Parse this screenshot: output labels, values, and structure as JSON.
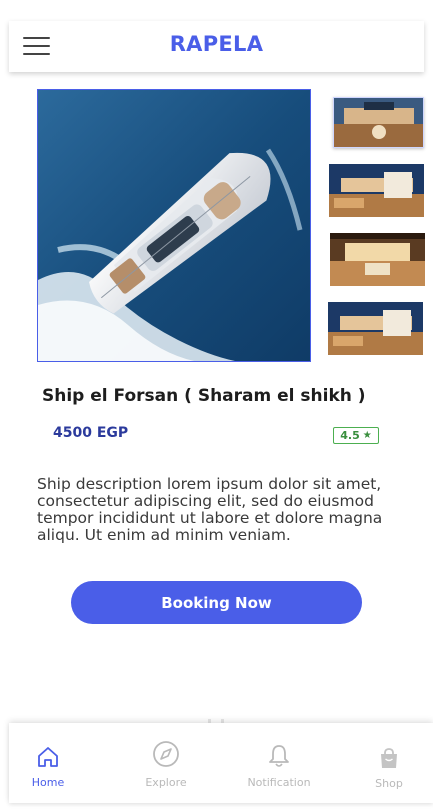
{
  "header": {
    "brand": "RAPELA",
    "menu_icon": "hamburger-menu-icon"
  },
  "product": {
    "title": "Ship el Forsan ( Sharam el shikh )",
    "price": "4500 EGP",
    "rating": "4.5",
    "rating_icon": "star-icon",
    "description": "Ship description lorem ipsum dolor sit amet, consectetur adipiscing elit, sed do eiusmod tempor incididunt ut labore et dolore magna aliqu. Ut enim ad minim veniam."
  },
  "gallery": {
    "main": "yacht-main-photo",
    "thumbnails": [
      "yacht-interior-thumb-1",
      "yacht-interior-thumb-2",
      "yacht-interior-thumb-3",
      "yacht-interior-thumb-4"
    ]
  },
  "cta": {
    "label": "Booking Now"
  },
  "tabbar": {
    "items": [
      {
        "label": "Home",
        "icon": "home-icon",
        "active": true
      },
      {
        "label": "Explore",
        "icon": "compass-icon",
        "active": false
      },
      {
        "label": "Notification",
        "icon": "bell-icon",
        "active": false
      },
      {
        "label": "Shop",
        "icon": "shopping-bag-icon",
        "active": false
      }
    ]
  },
  "colors": {
    "accent": "#4a5ee8",
    "rating": "#4caf50",
    "price": "#2b3a9c",
    "inactive": "#b9b9b9"
  }
}
